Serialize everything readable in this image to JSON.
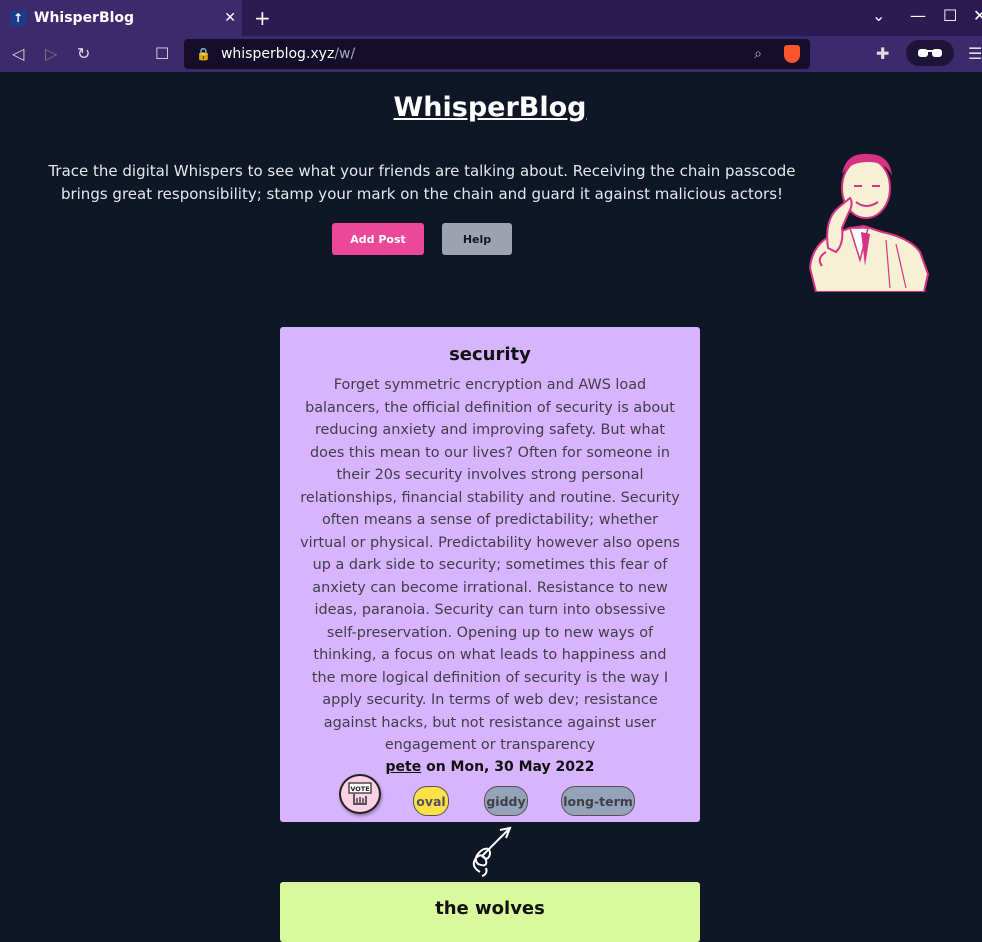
{
  "browser": {
    "tab_title": "WhisperBlog",
    "tab_favicon": "↑",
    "url_host": "whisperblog.xyz",
    "url_path": "/w/",
    "accent": "#3b2b6d"
  },
  "page": {
    "title": "WhisperBlog",
    "intro": "Trace the digital Whispers to see what your friends are talking about. Receiving the chain passcode brings great responsibility; stamp your mark on the chain and guard it against malicious actors!",
    "add_post": "Add Post",
    "help": "Help"
  },
  "posts": [
    {
      "title": "security",
      "body": "Forget symmetric encryption and AWS load balancers, the official definition of security is about reducing anxiety and improving safety. But what does this mean to our lives? Often for someone in their 20s security involves strong personal relationships, financial stability and routine. Security often means a sense of predictability; whether virtual or physical. Predictability however also opens up a dark side to security; sometimes this fear of anxiety can become irrational. Resistance to new ideas, paranoia. Security can turn into obsessive self-preservation. Opening up to new ways of thinking, a focus on what leads to happiness and the more logical definition of security is the way I apply security. In terms of web dev; resistance against hacks, but not resistance against user engagement or transparency",
      "author": "pete",
      "date_text": " on Mon, 30 May 2022",
      "vote_label": "VOTE",
      "tags": [
        "oval",
        "giddy",
        "long-term"
      ],
      "color": "#d8b4fe"
    },
    {
      "title": "the wolves",
      "color": "#d9f99d"
    }
  ]
}
